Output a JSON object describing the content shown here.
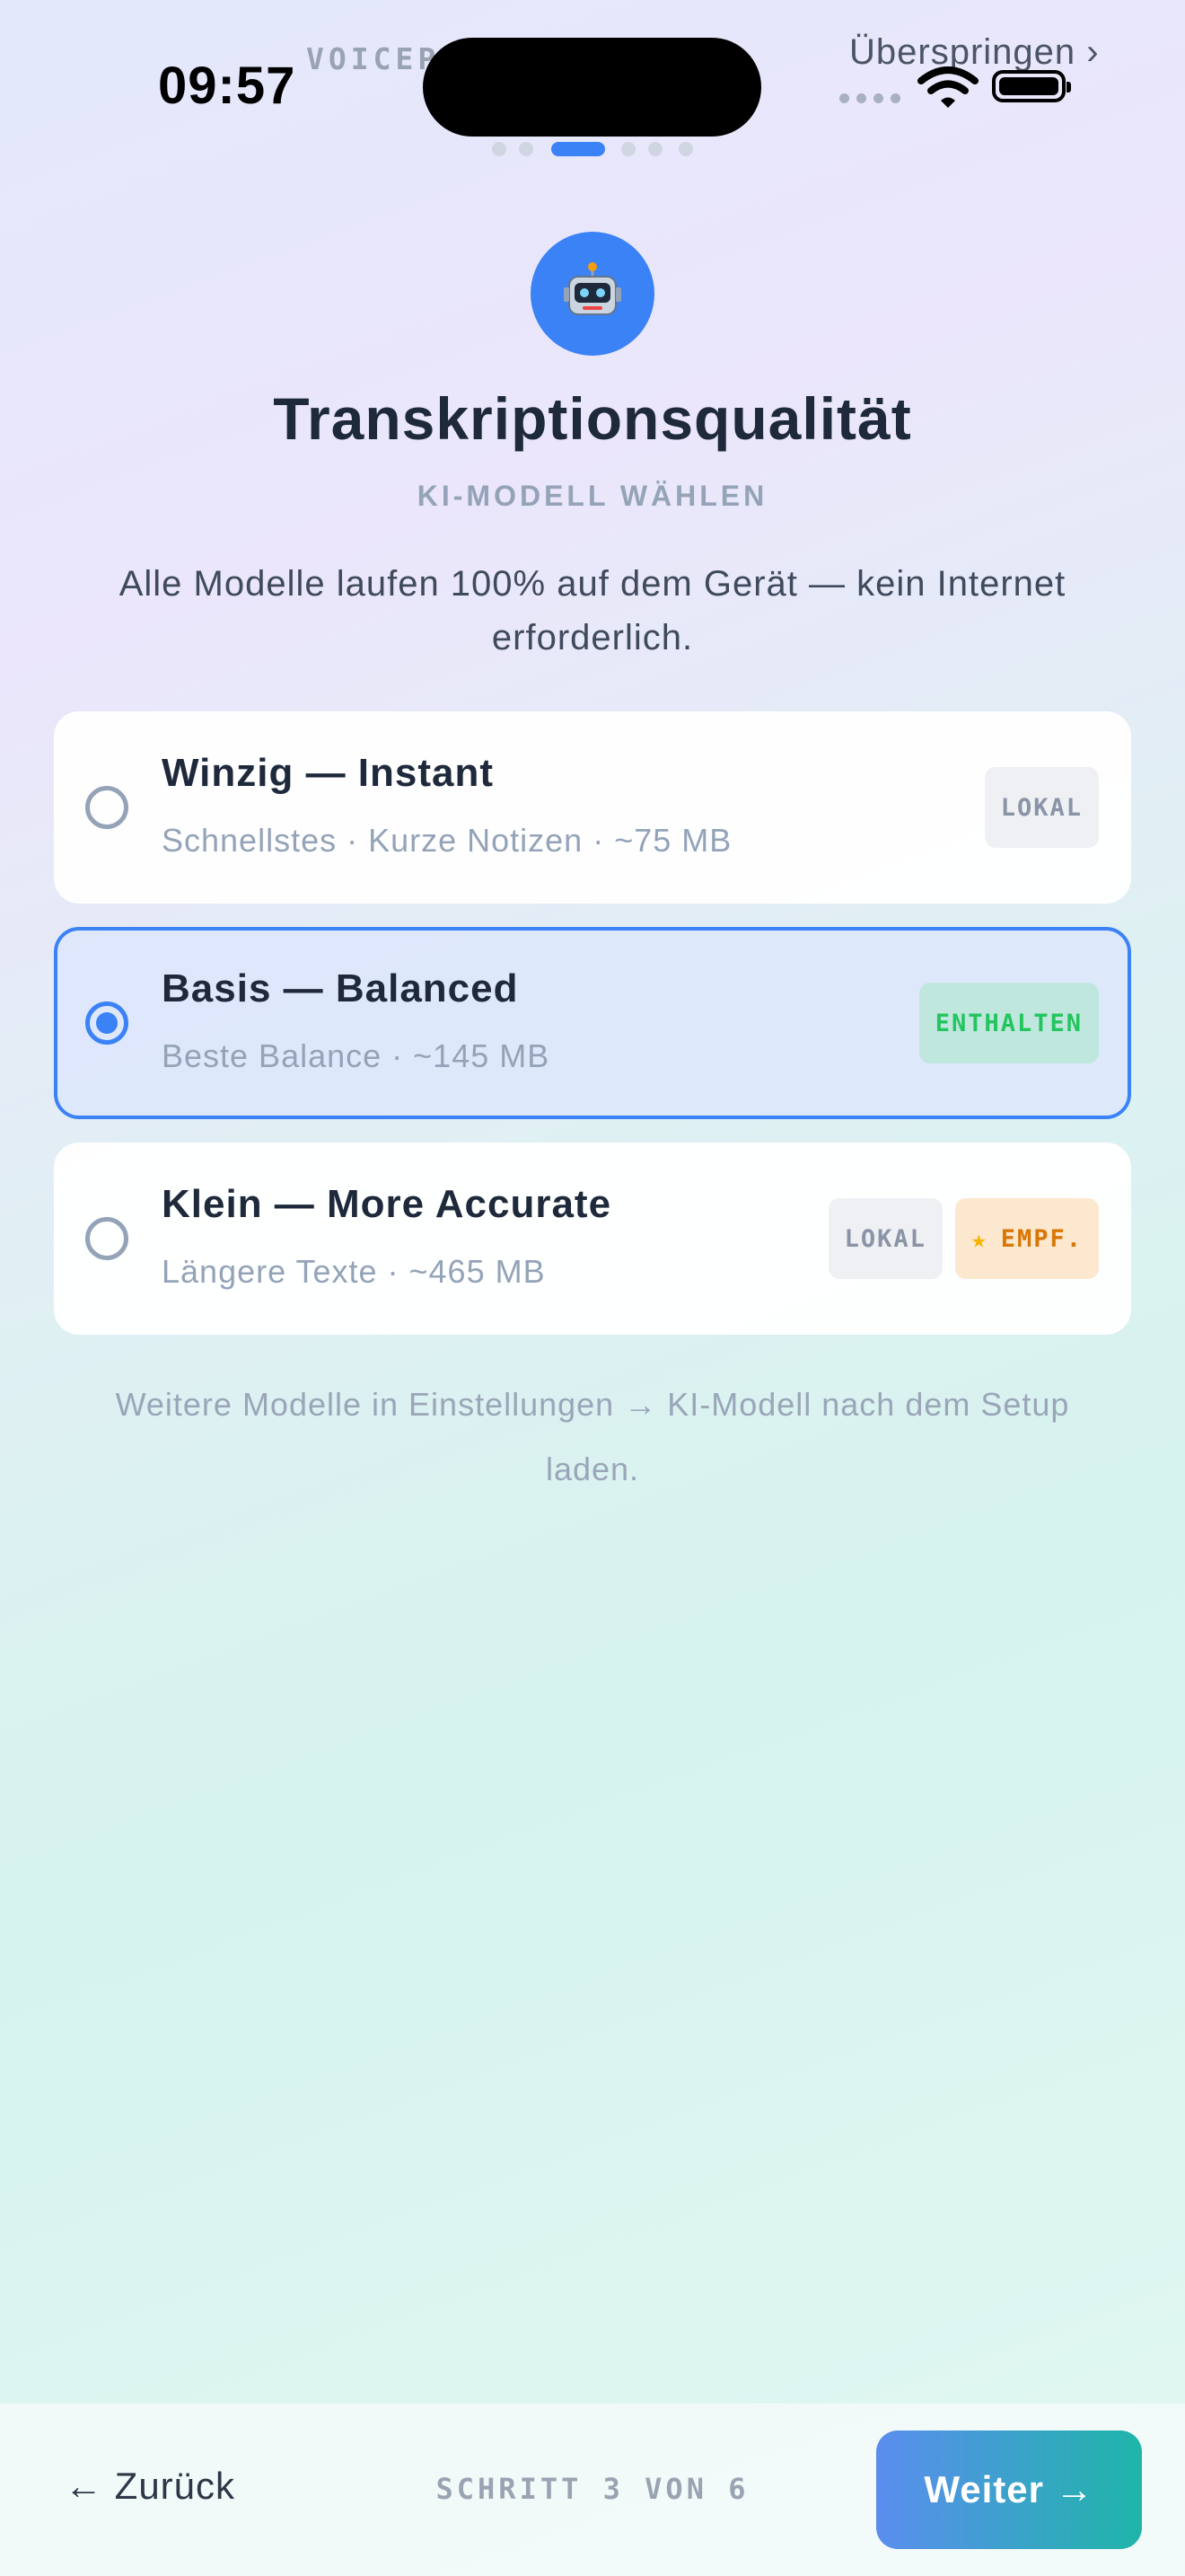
{
  "status_bar": {
    "time": "09:57",
    "brand": "VOICEP",
    "skip": "Überspringen ›"
  },
  "progress": {
    "current_step": 3,
    "total_steps": 6
  },
  "header": {
    "icon": "robot-icon",
    "title": "Transkriptionsqualität",
    "subtitle": "KI-MODELL WÄHLEN",
    "intro": "Alle Modelle laufen 100% auf dem Gerät — kein Internet erforderlich."
  },
  "models": [
    {
      "title": "Winzig — Instant",
      "subtitle": "Schnellstes · Kurze Notizen · ~75 MB",
      "selected": false,
      "badges": [
        "LOKAL"
      ]
    },
    {
      "title": "Basis — Balanced",
      "subtitle": "Beste Balance · ~145 MB",
      "selected": true,
      "badges": [
        "ENTHALTEN"
      ]
    },
    {
      "title": "Klein — More Accurate",
      "subtitle": "Längere Texte · ~465 MB",
      "selected": false,
      "badges": [
        "LOKAL",
        "EMPF."
      ]
    }
  ],
  "note": "Weitere Modelle in Einstellungen → KI-Modell nach dem Setup laden.",
  "footer": {
    "back": "← Zurück",
    "step": "SCHRITT 3 VON 6",
    "next": "Weiter →"
  },
  "colors": {
    "accent": "#3b82f6",
    "included": "#22c55e",
    "recommended": "#d97706"
  }
}
